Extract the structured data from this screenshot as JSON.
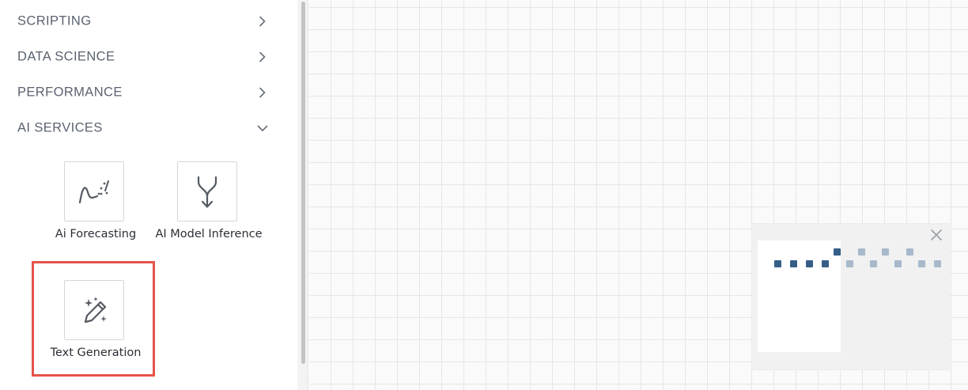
{
  "sidebar": {
    "categories": [
      {
        "label": "SCRIPTING",
        "state": "collapsed",
        "chevron_icon": "chevron-right-icon"
      },
      {
        "label": "DATA SCIENCE",
        "state": "collapsed",
        "chevron_icon": "chevron-right-icon"
      },
      {
        "label": "PERFORMANCE",
        "state": "collapsed",
        "chevron_icon": "chevron-right-icon"
      },
      {
        "label": "AI SERVICES",
        "state": "expanded",
        "chevron_icon": "chevron-down-icon"
      }
    ],
    "ai_services_items": [
      {
        "label": "Ai Forecasting",
        "icon": "forecast-chart-icon"
      },
      {
        "label": "AI Model Inference",
        "icon": "merge-arrow-icon"
      },
      {
        "label": "Text Generation",
        "icon": "magic-pencil-icon",
        "highlighted": true
      }
    ]
  },
  "minimap": {
    "close_icon": "close-icon"
  },
  "colors": {
    "category_text": "#5b6370",
    "tile_border": "#d4d6d9",
    "highlight_border": "#e5534b",
    "grid_line": "#e6e6e6",
    "minimap_dot_dark": "#355e88",
    "minimap_dot_light": "#a7b9cb"
  }
}
